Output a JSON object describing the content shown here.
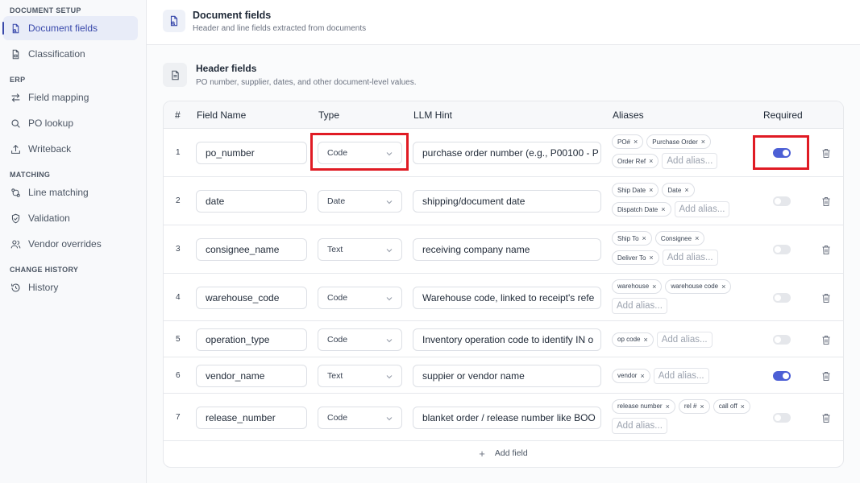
{
  "sidebar": {
    "sections": [
      {
        "title": "DOCUMENT SETUP",
        "items": [
          {
            "label": "Document fields",
            "icon": "document-code-icon",
            "active": true
          },
          {
            "label": "Classification",
            "icon": "document-tag-icon"
          }
        ]
      },
      {
        "title": "ERP",
        "items": [
          {
            "label": "Field mapping",
            "icon": "arrows-swap-icon"
          },
          {
            "label": "PO lookup",
            "icon": "search-icon"
          },
          {
            "label": "Writeback",
            "icon": "upload-icon"
          }
        ]
      },
      {
        "title": "MATCHING",
        "items": [
          {
            "label": "Line matching",
            "icon": "git-compare-icon"
          },
          {
            "label": "Validation",
            "icon": "shield-check-icon"
          },
          {
            "label": "Vendor overrides",
            "icon": "users-icon"
          }
        ]
      },
      {
        "title": "CHANGE HISTORY",
        "items": [
          {
            "label": "History",
            "icon": "history-icon"
          }
        ]
      }
    ]
  },
  "header": {
    "title": "Document fields",
    "subtitle": "Header and line fields extracted from documents"
  },
  "section": {
    "title": "Header fields",
    "subtitle": "PO number, supplier, dates, and other document-level values."
  },
  "table": {
    "columns": [
      "#",
      "Field Name",
      "Type",
      "LLM Hint",
      "Aliases",
      "Required"
    ],
    "alias_placeholder": "Add alias...",
    "rows": [
      {
        "num": "1",
        "field": "po_number",
        "type": "Code",
        "hint": "purchase order number (e.g., P00100 - P",
        "aliases": [
          "PO#",
          "Purchase Order",
          "Order Ref"
        ],
        "required": true
      },
      {
        "num": "2",
        "field": "date",
        "type": "Date",
        "hint": "shipping/document date",
        "aliases": [
          "Ship Date",
          "Date",
          "Dispatch Date"
        ],
        "required": false
      },
      {
        "num": "3",
        "field": "consignee_name",
        "type": "Text",
        "hint": "receiving company name",
        "aliases": [
          "Ship To",
          "Consignee",
          "Deliver To"
        ],
        "required": false
      },
      {
        "num": "4",
        "field": "warehouse_code",
        "type": "Code",
        "hint": "Warehouse code, linked to receipt's refe",
        "aliases": [
          "warehouse",
          "warehouse code"
        ],
        "required": false
      },
      {
        "num": "5",
        "field": "operation_type",
        "type": "Code",
        "hint": "Inventory operation code to identify IN o",
        "aliases": [
          "op code"
        ],
        "required": false
      },
      {
        "num": "6",
        "field": "vendor_name",
        "type": "Text",
        "hint": "suppier or vendor name",
        "aliases": [
          "vendor"
        ],
        "required": true
      },
      {
        "num": "7",
        "field": "release_number",
        "type": "Code",
        "hint": "blanket order / release number like BOO",
        "aliases": [
          "release number",
          "rel #",
          "call off"
        ],
        "required": false
      }
    ],
    "add_field_label": "Add field"
  },
  "colors": {
    "accent": "#3949ab",
    "toggle_on": "#4c5fd5",
    "highlight": "#e01b24"
  }
}
